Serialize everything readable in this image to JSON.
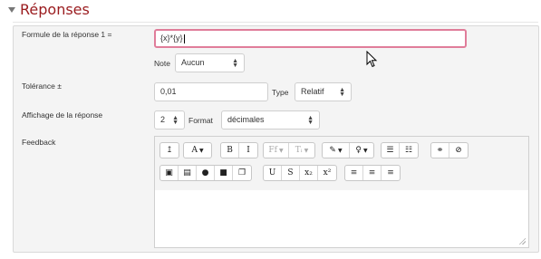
{
  "section": {
    "title": "Réponses",
    "collapse_icon": "caret-down-icon"
  },
  "answer_formula": {
    "label": "Formule de la réponse 1 =",
    "value": "{x}*{y}"
  },
  "grade": {
    "label": "Note",
    "value": "Aucun"
  },
  "tolerance": {
    "label": "Tolérance ±",
    "value": "0,01"
  },
  "tolerance_type": {
    "label": "Type",
    "value": "Relatif"
  },
  "display": {
    "label": "Affichage de la réponse",
    "value": "2"
  },
  "format": {
    "label": "Format",
    "value": "décimales"
  },
  "feedback": {
    "label": "Feedback",
    "toolbar_row1": [
      {
        "name": "collapse-toolbar-button",
        "glyph": "↥",
        "dropdown": false,
        "dim": false,
        "w": 20
      },
      {
        "name": "font-color-button",
        "glyph": "A",
        "dropdown": true,
        "dim": false,
        "w": 30
      },
      {
        "name": "bold-button",
        "glyph": "B",
        "dropdown": false,
        "dim": false,
        "w": 20
      },
      {
        "name": "italic-button",
        "glyph": "I",
        "dropdown": false,
        "dim": false,
        "w": 20
      },
      {
        "name": "font-family-button",
        "glyph": "Ff",
        "dropdown": true,
        "dim": true,
        "w": 28
      },
      {
        "name": "font-size-button",
        "glyph": "Tᵢ",
        "dropdown": true,
        "dim": true,
        "w": 28
      },
      {
        "name": "brush-button",
        "glyph": "✎",
        "dropdown": true,
        "dim": false,
        "w": 30
      },
      {
        "name": "lightbulb-button",
        "glyph": "♀",
        "dropdown": true,
        "dim": false,
        "w": 26
      },
      {
        "name": "unordered-list-button",
        "glyph": "☰",
        "dropdown": false,
        "dim": false,
        "w": 20
      },
      {
        "name": "ordered-list-button",
        "glyph": "☷",
        "dropdown": false,
        "dim": false,
        "w": 20
      },
      {
        "name": "link-button",
        "glyph": "⚭",
        "dropdown": false,
        "dim": false,
        "w": 20
      },
      {
        "name": "unlink-button",
        "glyph": "⊘",
        "dropdown": false,
        "dim": false,
        "w": 20
      }
    ],
    "toolbar_row2": [
      {
        "name": "image-button",
        "glyph": "▣",
        "dim": false,
        "w": 20
      },
      {
        "name": "document-button",
        "glyph": "▤",
        "dim": false,
        "w": 20
      },
      {
        "name": "microphone-button",
        "glyph": "●",
        "dim": false,
        "w": 20
      },
      {
        "name": "video-button",
        "glyph": "■",
        "dim": false,
        "w": 20
      },
      {
        "name": "copy-button",
        "glyph": "❐",
        "dim": false,
        "w": 20
      },
      {
        "name": "underline-button",
        "glyph": "U",
        "dim": false,
        "w": 20
      },
      {
        "name": "strikethrough-button",
        "glyph": "S",
        "dim": false,
        "w": 20
      },
      {
        "name": "subscript-button",
        "glyph": "x₂",
        "dim": false,
        "w": 20
      },
      {
        "name": "superscript-button",
        "glyph": "x²",
        "dim": false,
        "w": 20
      },
      {
        "name": "align-left-button",
        "glyph": "≡",
        "dim": false,
        "w": 20
      },
      {
        "name": "align-center-button",
        "glyph": "≡",
        "dim": false,
        "w": 20
      },
      {
        "name": "align-right-button",
        "glyph": "≡",
        "dim": false,
        "w": 20
      }
    ]
  },
  "colors": {
    "title": "#9a1b1e",
    "focus_border": "#e07d9a",
    "panel_bg": "#f4f4f4"
  }
}
